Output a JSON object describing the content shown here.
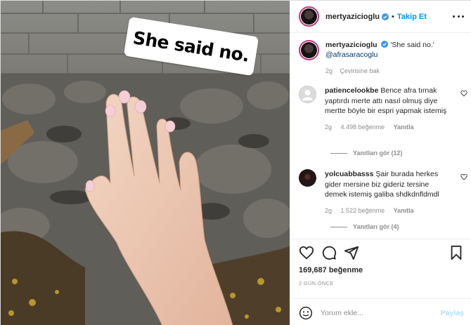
{
  "post": {
    "username": "mertyazicioglu",
    "follow_label": "Takip Et",
    "separator": "•",
    "sticker_text": "She said no."
  },
  "caption": {
    "username": "mertyazicioglu",
    "text": "'She said no.'",
    "mention": "@afrasaracoglu",
    "age": "2g",
    "translate": "Çevirisine bak"
  },
  "comments": [
    {
      "username": "patiencelookbe",
      "text": "Bence afra tırnak yaptırdı merte attı nasıl olmuş diye mertte böyle bir espri yapmak istemiş",
      "age": "2g",
      "likes": "4.498 beğenme",
      "reply_label": "Yanıtla",
      "view_replies": "Yanıtları gör (12)"
    },
    {
      "username": "yolcuabbasss",
      "text": "Şair burada herkes gider mersine biz gideriz tersine demek istemiş galiba shdkdnfldmdl",
      "age": "2g",
      "likes": "1.522 beğenme",
      "reply_label": "Yanıtla",
      "view_replies": "Yanıtları gör (4)"
    }
  ],
  "actions": {
    "likes": "169,687 beğenme",
    "time": "2 GÜN ÖNCE",
    "comment_placeholder": "Yorum ekle...",
    "post_label": "Paylaş",
    "icons": [
      "heart-icon",
      "comment-icon",
      "share-icon",
      "bookmark-icon",
      "emoji-icon",
      "more-icon",
      "verified-icon"
    ]
  },
  "colors": {
    "accent": "#0095f6",
    "verified": "#3897f0",
    "muted": "#8e8e8e",
    "post_disabled": "#b2dffc"
  }
}
